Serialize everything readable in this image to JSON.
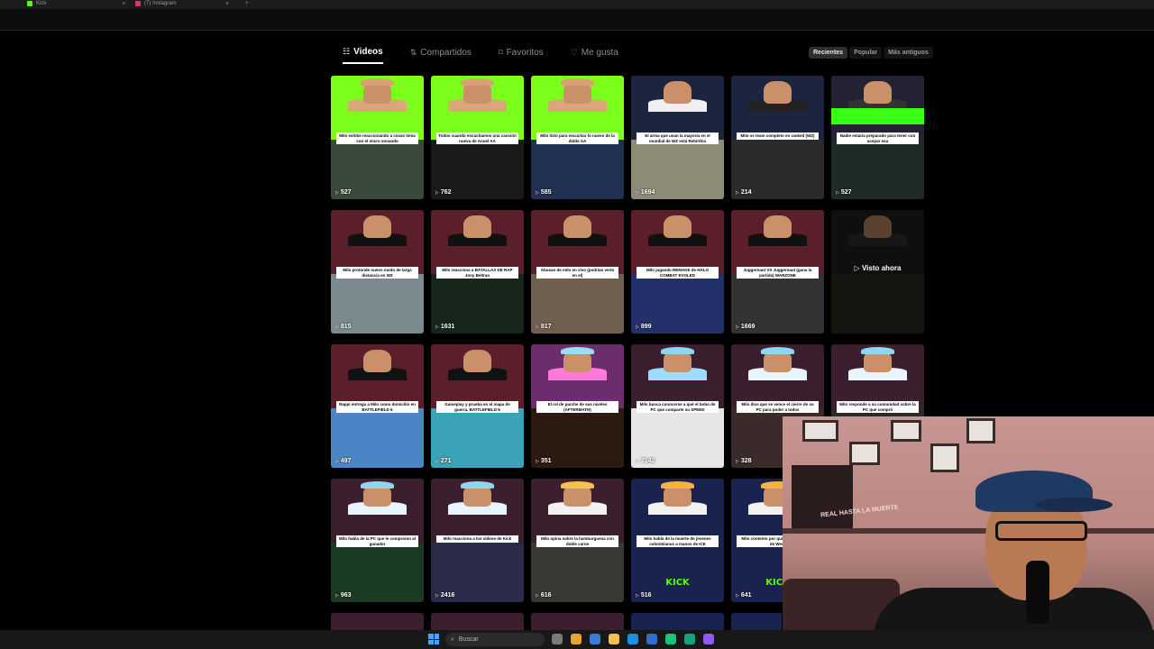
{
  "browser": {
    "tabs": [
      {
        "label": "Kick",
        "icon": "kick-icon",
        "color": "#53fc18"
      },
      {
        "label": "(7) Instagram",
        "icon": "instagram-icon",
        "color": "#e1306c"
      }
    ]
  },
  "nav": {
    "tabs": [
      {
        "label": "Videos",
        "icon": "grid-icon",
        "active": true
      },
      {
        "label": "Compartidos",
        "icon": "repost-icon",
        "active": false
      },
      {
        "label": "Favoritos",
        "icon": "bookmark-icon",
        "active": false
      },
      {
        "label": "Me gusta",
        "icon": "heart-icon",
        "active": false
      }
    ],
    "sort": [
      {
        "label": "Recientes",
        "active": true
      },
      {
        "label": "Popular",
        "active": false
      },
      {
        "label": "Más antiguos",
        "active": false
      }
    ]
  },
  "videos": [
    {
      "caption": "Milo exhibe reaccionando a cosas tema con el micro sonando",
      "views": "527"
    },
    {
      "caption": "Todos cuando escuchamos una canción nueva de Anuel AA",
      "views": "762"
    },
    {
      "caption": "Milo listo para escuchar lo nuevo de la doble AA",
      "views": "585"
    },
    {
      "caption": "El arma que usan la mayoría en el mundial de WZ está Rebirthia",
      "views": "1694"
    },
    {
      "caption": "Milo vs team completo en ranked (WZ)",
      "views": "214"
    },
    {
      "caption": "Nadie estaría preparado para tener con acepar esa",
      "views": "527"
    },
    {
      "caption": "Milo protonde nuevo modo de larga distancia en WZ",
      "views": "815"
    },
    {
      "caption": "Milo reacciona a BATALLAS DE RAP Jony Beltran",
      "views": "1631"
    },
    {
      "caption": "Abusan de milo en vivo (podrían verlo en el)",
      "views": "817"
    },
    {
      "caption": "Milo jugando REMAKE de HALO COMBAT EVOLED",
      "views": "899"
    },
    {
      "caption": "Juggernaut VS Juggernaut (gana la partida) WARZONE",
      "views": "1669"
    },
    {
      "caption": "",
      "views": "",
      "seen": "Visto ahora"
    },
    {
      "caption": "Rappi entrega a Milo como domicilio en BATTLEFIELD 6",
      "views": "497"
    },
    {
      "caption": "Gameplay y prueba en el mapa de guerra, BATTLEFIELD 6",
      "views": "271"
    },
    {
      "caption": "El rol de parche de sus niveles (AFTERMATH)",
      "views": "351"
    },
    {
      "caption": "Milo busca conocerse a qué el bobo de PC que comparte su SPEED",
      "views": "7142"
    },
    {
      "caption": "Milo dice que se vence el cierre de su PC para poder a todos",
      "views": "328"
    },
    {
      "caption": "Milo responde a su comunidad sobre la PC que compró",
      "views": ""
    },
    {
      "caption": "Milo habla de la PC que le compraron al ganador",
      "views": "963"
    },
    {
      "caption": "Milo reacciona a los videos de Kick",
      "views": "2416"
    },
    {
      "caption": "Milo opina sobre la hamburguesa con doble carne",
      "views": "616"
    },
    {
      "caption": "Milo habla de la muerte de jóvenes colombianos a manos de ICE",
      "views": "516"
    },
    {
      "caption": "Milo contento por que ganó el premio de West",
      "views": "641"
    }
  ],
  "webcam": {
    "poster_text": "REAL HASTA LA MUERTE"
  },
  "taskbar": {
    "search_placeholder": "Buscar"
  },
  "colors": {
    "kick_green": "#53fc18",
    "background": "#000000"
  }
}
